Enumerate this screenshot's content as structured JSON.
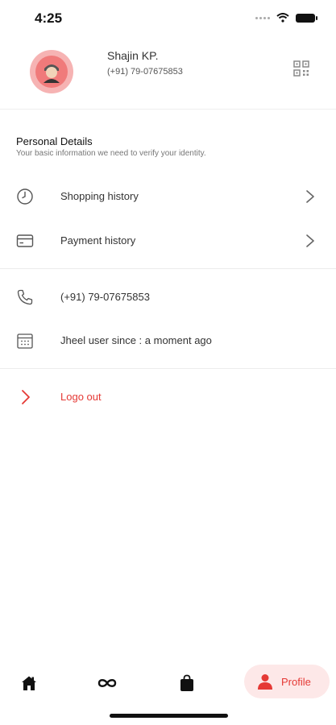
{
  "status": {
    "time": "4:25"
  },
  "profile": {
    "name": "Shajin KP.",
    "phone": "(+91)  79-07675853"
  },
  "personal_details": {
    "title": "Personal Details",
    "subtitle": "Your basic information we need to verify your identity."
  },
  "menu": {
    "shopping_history": "Shopping history",
    "payment_history": "Payment history"
  },
  "info": {
    "phone": "(+91)  79-07675853",
    "user_since": "Jheel user since : a moment ago"
  },
  "logout": {
    "label": "Logo out"
  },
  "bottom_nav": {
    "profile_label": "Profile"
  },
  "colors": {
    "accent": "#e53935",
    "accent_soft": "#fde8e8",
    "avatar_ring": "#f6b3b3"
  }
}
